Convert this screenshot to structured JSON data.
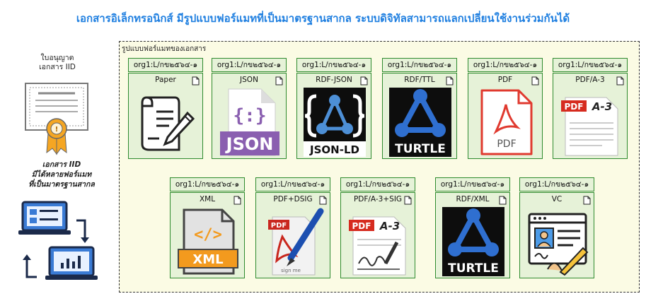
{
  "title": "เอกสารอิเล็กทรอนิกส์ มีรูปแบบฟอร์แมทที่เป็นมาตรฐานสากล ระบบดิจิทัลสามารถแลกเปลี่ยนใช้งานร่วมกันได้",
  "left": {
    "caption_top_line1": "ใบอนุญาต",
    "caption_top_line2": "เอกสาร IID",
    "caption_bottom_line1": "เอกสาร IID",
    "caption_bottom_line2": "มีได้หลายฟอร์แมท",
    "caption_bottom_line3": "ที่เป็นมาตรฐานสากล"
  },
  "panel": {
    "label": "รูปแบบฟอร์แมทของเอกสาร",
    "cards": [
      {
        "tag": "org1:L/กข๒๕๖๔-๑",
        "format": "Paper",
        "logo": "paper-pen-icon"
      },
      {
        "tag": "org1:L/กข๒๕๖๔-๑",
        "format": "JSON",
        "logo": "json-file-icon"
      },
      {
        "tag": "org1:L/กข๒๕๖๔-๑",
        "format": "RDF-JSON",
        "logo": "json-ld-logo",
        "logo_text": "JSON-LD"
      },
      {
        "tag": "org1:L/กข๒๕๖๔-๑",
        "format": "RDF/TTL",
        "logo": "turtle-logo",
        "logo_text": "TURTLE"
      },
      {
        "tag": "org1:L/กข๒๕๖๔-๑",
        "format": "PDF",
        "logo": "pdf-file-icon",
        "logo_text": "PDF"
      },
      {
        "tag": "org1:L/กข๒๕๖๔-๑",
        "format": "PDF/A-3",
        "logo": "pdf-a3-icon",
        "logo_text": "PDF A-3"
      },
      {
        "tag": "org1:L/กข๒๕๖๔-๑",
        "format": "XML",
        "logo": "xml-file-icon",
        "logo_text": "XML"
      },
      {
        "tag": "org1:L/กข๒๕๖๔-๑",
        "format": "PDF+DSIG",
        "logo": "pdf-signature-icon",
        "logo_text": "PDF"
      },
      {
        "tag": "org1:L/กข๒๕๖๔-๑",
        "format": "PDF/A-3+SIG",
        "logo": "pdf-a3-sign-icon",
        "logo_text": "PDF A-3"
      },
      {
        "tag": "org1:L/กข๒๕๖๔-๑",
        "format": "RDF/XML",
        "logo": "turtle-logo",
        "logo_text": "TURTLE"
      },
      {
        "tag": "org1:L/กข๒๕๖๔-๑",
        "format": "VC",
        "logo": "verifiable-credential-icon"
      }
    ]
  },
  "colors": {
    "title": "#1f7fe0",
    "card_fill": "#e6f2d8",
    "card_border": "#2e8b2e",
    "panel_fill": "#fbfbe4"
  }
}
